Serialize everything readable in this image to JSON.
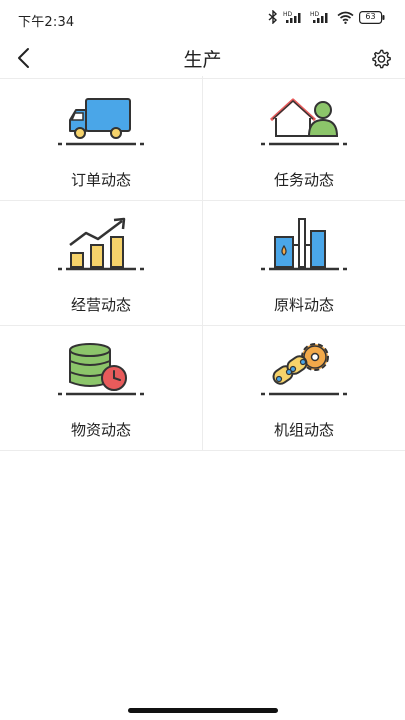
{
  "status_bar": {
    "time": "下午2:34",
    "battery": "63",
    "icons": [
      "bluetooth-icon",
      "hd-signal-icon",
      "hd-signal-icon",
      "wifi-icon",
      "battery-icon"
    ]
  },
  "header": {
    "title": "生产",
    "back_icon": "chevron-left-icon",
    "settings_icon": "gear-icon"
  },
  "menu": {
    "items": [
      {
        "label": "订单动态",
        "icon": "delivery-truck-icon"
      },
      {
        "label": "任务动态",
        "icon": "home-user-icon"
      },
      {
        "label": "经营动态",
        "icon": "growth-chart-icon"
      },
      {
        "label": "原料动态",
        "icon": "raw-material-tank-icon"
      },
      {
        "label": "物资动态",
        "icon": "database-clock-icon"
      },
      {
        "label": "机组动态",
        "icon": "gear-chain-icon"
      }
    ]
  },
  "colors": {
    "blue": "#4aa6e8",
    "yellow": "#f6d36b",
    "green": "#8cc56a",
    "red": "#e85b5b",
    "orange": "#f2a94a",
    "outline": "#333333",
    "divider": "#ececec"
  }
}
